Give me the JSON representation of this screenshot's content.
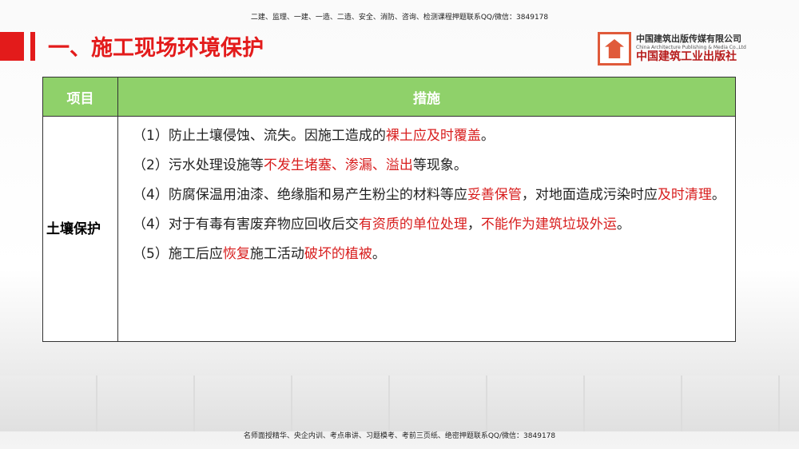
{
  "top_note": "二建、监理、一建、一造、二造、安全、消防、咨询、检测课程押题联系QQ/微信：3849178",
  "title": "一、施工现场环境保护",
  "logo": {
    "cn": "中国建筑出版传媒有限公司",
    "en": "China Architecture Publishing & Media Co.,Ltd",
    "sub": "中国建筑工业出版社"
  },
  "table": {
    "headers": [
      "项目",
      "措施"
    ],
    "category": "土壤保护",
    "items": [
      [
        {
          "t": "（1）防止土壤侵蚀、流失。因施工造成的",
          "r": false
        },
        {
          "t": "裸土应及时覆盖",
          "r": true
        },
        {
          "t": "。",
          "r": false
        }
      ],
      [
        {
          "t": "（2）污水处理设施等",
          "r": false
        },
        {
          "t": "不发生堵塞、渗漏、溢出",
          "r": true
        },
        {
          "t": "等现象。",
          "r": false
        }
      ],
      [
        {
          "t": "（4）防腐保温用油漆、绝缘脂和易产生粉尘的材料等应",
          "r": false
        },
        {
          "t": "妥善保管",
          "r": true
        },
        {
          "t": "，对地面造成污染时应",
          "r": false
        },
        {
          "t": "及时清理",
          "r": true
        },
        {
          "t": "。",
          "r": false
        }
      ],
      [
        {
          "t": "（4）对于有毒有害废弃物应回收后交",
          "r": false
        },
        {
          "t": "有资质的单位处理",
          "r": true
        },
        {
          "t": "，",
          "r": false
        },
        {
          "t": "不能作为建筑垃圾外运",
          "r": true
        },
        {
          "t": "。",
          "r": false
        }
      ],
      [
        {
          "t": "（5）施工后应",
          "r": false
        },
        {
          "t": "恢复",
          "r": true
        },
        {
          "t": "施工活动",
          "r": false
        },
        {
          "t": "破坏的植被",
          "r": true
        },
        {
          "t": "。",
          "r": false
        }
      ]
    ]
  },
  "footer": "名师面授精华、央企内训、考点串讲、习题模考、考前三页纸、绝密押题联系QQ/微信：3849178",
  "colors": {
    "accent": "#e31b1b",
    "header": "#8fd16a",
    "highlight": "#d81e1e"
  }
}
